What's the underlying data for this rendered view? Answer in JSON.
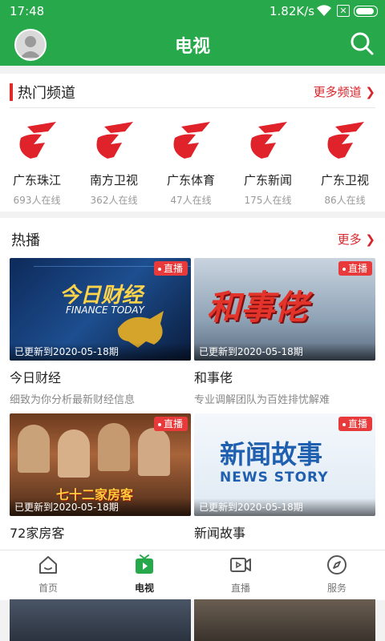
{
  "status_bar": {
    "time": "17:48",
    "speed": "1.82K/s"
  },
  "header": {
    "title": "电视",
    "avatar_icon": "user-avatar-icon",
    "search_icon": "search-icon"
  },
  "hot_channels": {
    "title": "热门频道",
    "more": "更多频道 ❯",
    "items": [
      {
        "name": "广东珠江",
        "online": "693人在线"
      },
      {
        "name": "南方卫视",
        "online": "362人在线"
      },
      {
        "name": "广东体育",
        "online": "47人在线"
      },
      {
        "name": "广东新闻",
        "online": "175人在线"
      },
      {
        "name": "广东卫视",
        "online": "86人在线"
      }
    ]
  },
  "hot_play": {
    "title": "热播",
    "more": "更多 ❯",
    "live_label": "直播",
    "items": [
      {
        "title": "今日财经",
        "desc": "细致为你分析最新财经信息",
        "update": "已更新到2020-05-18期",
        "thumb_text": "今日财经",
        "thumb_sub": "FINANCE TODAY"
      },
      {
        "title": "和事佬",
        "desc": "专业调解团队为百姓排忧解难",
        "update": "已更新到2020-05-18期",
        "thumb_text": "和事佬"
      },
      {
        "title": "72家房客",
        "desc": "",
        "update": "已更新到2020-05-18期",
        "thumb_text": "七十二家房客"
      },
      {
        "title": "新闻故事",
        "desc": "",
        "update": "已更新到2020-05-18期",
        "thumb_text": "新闻故事",
        "thumb_sub": "NEWS STORY"
      }
    ]
  },
  "bottom_nav": [
    {
      "label": "首页",
      "icon": "home-icon"
    },
    {
      "label": "电视",
      "icon": "tv-icon"
    },
    {
      "label": "直播",
      "icon": "live-video-icon"
    },
    {
      "label": "服务",
      "icon": "compass-icon"
    }
  ],
  "colors": {
    "brand_green": "#27a84a",
    "accent_red": "#d7262b",
    "live_red": "#e83a3a"
  }
}
